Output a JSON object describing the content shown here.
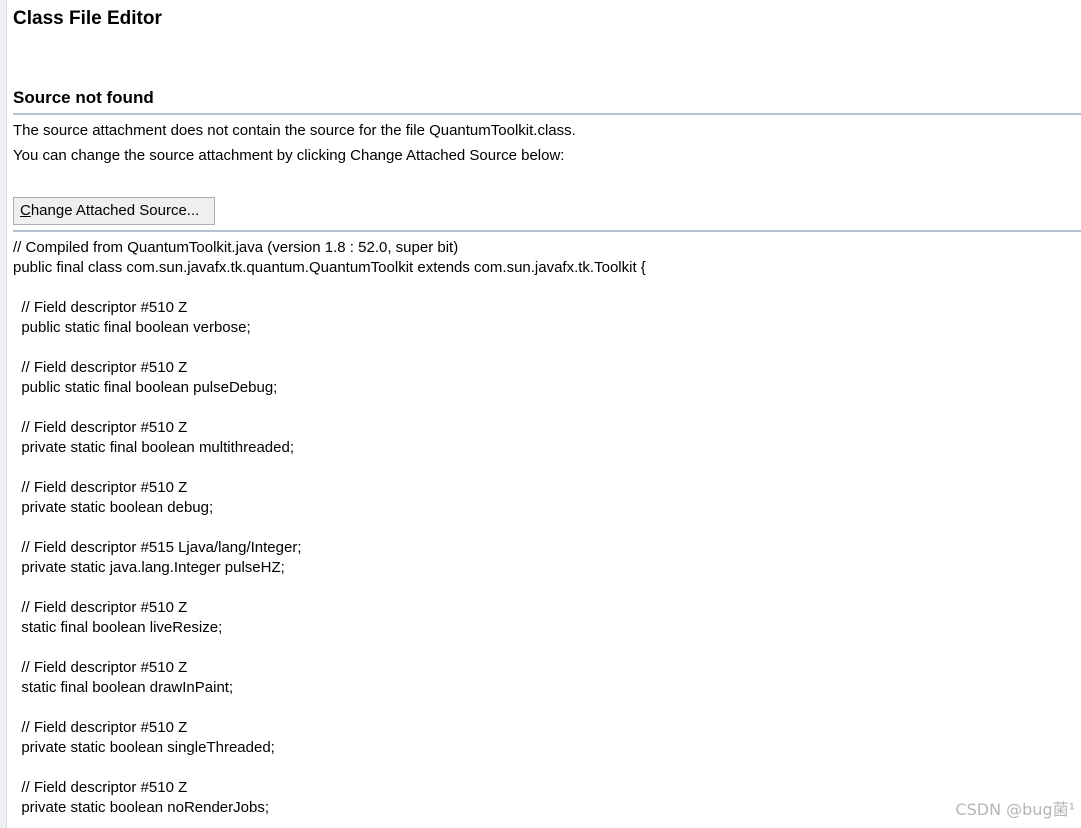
{
  "editor": {
    "title": "Class File Editor"
  },
  "source_not_found": {
    "heading": "Source not found",
    "message_1": "The source attachment does not contain the source for the file QuantumToolkit.class.",
    "message_2": "You can change the source attachment by clicking Change Attached Source below:",
    "button": {
      "mnemonic": "C",
      "rest": "hange Attached Source..."
    }
  },
  "code_lines": [
    "// Compiled from QuantumToolkit.java (version 1.8 : 52.0, super bit)",
    "public final class com.sun.javafx.tk.quantum.QuantumToolkit extends com.sun.javafx.tk.Toolkit {",
    "",
    "  // Field descriptor #510 Z",
    "  public static final boolean verbose;",
    "",
    "  // Field descriptor #510 Z",
    "  public static final boolean pulseDebug;",
    "",
    "  // Field descriptor #510 Z",
    "  private static final boolean multithreaded;",
    "",
    "  // Field descriptor #510 Z",
    "  private static boolean debug;",
    "",
    "  // Field descriptor #515 Ljava/lang/Integer;",
    "  private static java.lang.Integer pulseHZ;",
    "",
    "  // Field descriptor #510 Z",
    "  static final boolean liveResize;",
    "",
    "  // Field descriptor #510 Z",
    "  static final boolean drawInPaint;",
    "",
    "  // Field descriptor #510 Z",
    "  private static boolean singleThreaded;",
    "",
    "  // Field descriptor #510 Z",
    "  private static boolean noRenderJobs;"
  ],
  "watermark": "CSDN @bug菌¹"
}
